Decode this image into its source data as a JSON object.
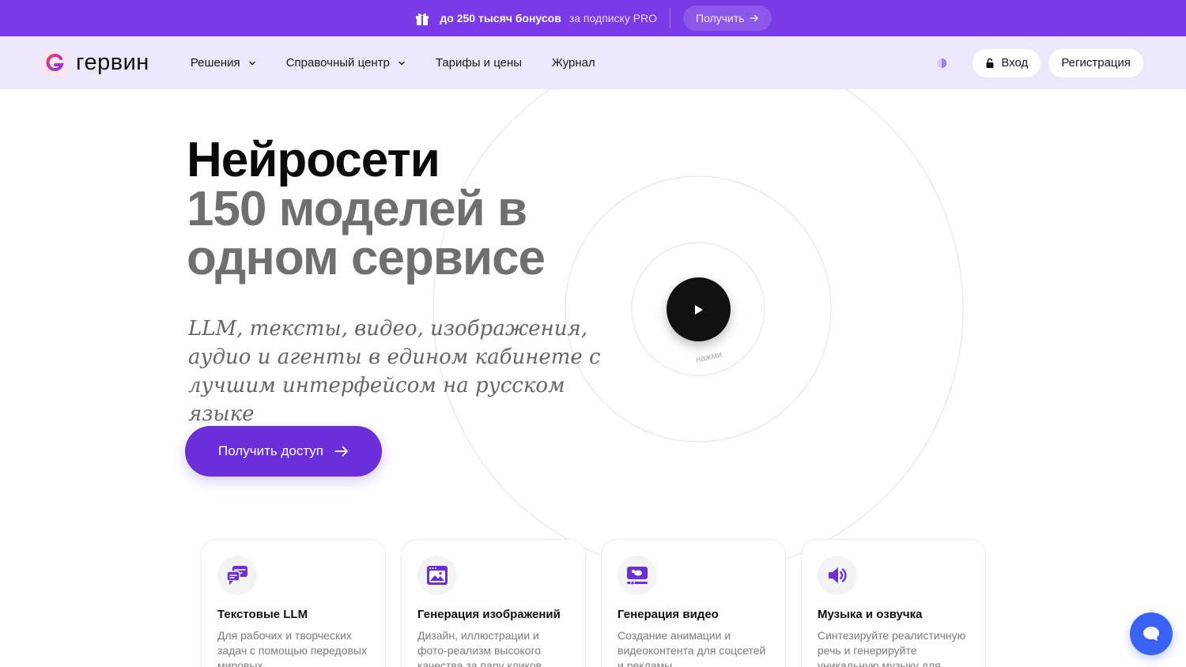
{
  "promo": {
    "bonus_text": "до 250 тысяч бонусов",
    "subscription_text": "за подписку PRO",
    "get_label": "Получить"
  },
  "header": {
    "brand": "гервин",
    "nav": [
      {
        "label": "Решения",
        "has_dropdown": true
      },
      {
        "label": "Справочный центр",
        "has_dropdown": true
      },
      {
        "label": "Тарифы и цены",
        "has_dropdown": false
      },
      {
        "label": "Журнал",
        "has_dropdown": false
      }
    ],
    "login_label": "Вход",
    "register_label": "Регистрация"
  },
  "hero": {
    "title_line1": "Нейросети",
    "title_line2": "150 моделей в одном сервисе",
    "subtitle": "LLM, тексты, видео, изображения, аудио и агенты в едином кабинете с лучшим интерфейсом на русском языке",
    "cta_label": "Получить доступ",
    "play_hint": "нажми"
  },
  "cards": [
    {
      "icon": "chat-bubbles-icon",
      "title": "Текстовые LLM",
      "desc": "Для рабочих и творческих задач с помощью передовых мировых"
    },
    {
      "icon": "image-window-icon",
      "title": "Генерация изображений",
      "desc": "Дизайн, иллюстрации и фото-реализм высокого качества за пару кликов"
    },
    {
      "icon": "video-icon",
      "title": "Генерация видео",
      "desc": "Создание анимации и видеоконтента для соцсетей и рекламы"
    },
    {
      "icon": "speaker-icon",
      "title": "Музыка и озвучка",
      "desc": "Синтезируйте реалистичную речь и генерируйте уникальную музыку для"
    }
  ],
  "colors": {
    "promo_bg": "#7a3be6",
    "header_bg": "#ece7fb",
    "accent": "#6b2fd9",
    "chat_button": "#3a63f5"
  }
}
